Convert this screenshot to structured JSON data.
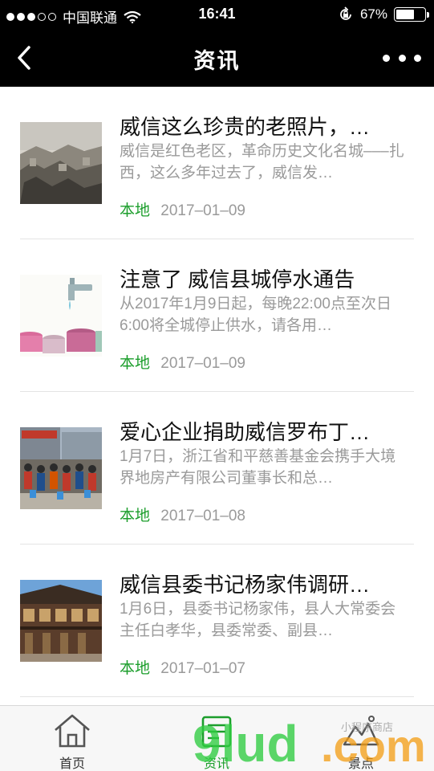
{
  "status_bar": {
    "carrier": "中国联通",
    "time": "16:41",
    "battery": "67%",
    "battery_level": 0.67
  },
  "nav": {
    "title": "资讯"
  },
  "articles": [
    {
      "title": "威信这么珍贵的老照片，…",
      "desc": "威信是红色老区，革命历史文化名城–––扎西，这么多年过去了，威信发…",
      "tag": "本地",
      "date": "2017–01–09",
      "thumb_icon": "old-photo-thumbnail"
    },
    {
      "title": "注意了 威信县城停水通告",
      "desc": "从2017年1月9日起，每晚22:00点至次日6:00将全城停止供水，请各用…",
      "tag": "本地",
      "date": "2017–01–09",
      "thumb_icon": "water-tap-thumbnail"
    },
    {
      "title": "爱心企业捐助威信罗布丁…",
      "desc": "1月7日，浙江省和平慈善基金会携手大境界地房产有限公司董事长和总…",
      "tag": "本地",
      "date": "2017–01–08",
      "thumb_icon": "donation-event-thumbnail"
    },
    {
      "title": "威信县委书记杨家伟调研…",
      "desc": "1月6日，县委书记杨家伟，县人大常委会主任白孝华，县委常委、副县…",
      "tag": "本地",
      "date": "2017–01–07",
      "thumb_icon": "old-street-thumbnail"
    }
  ],
  "tab_bar": {
    "tabs": [
      {
        "label": "首页",
        "icon": "home-icon"
      },
      {
        "label": "资讯",
        "icon": "news-icon"
      },
      {
        "label": "景点",
        "icon": "mountain-icon"
      }
    ],
    "active_index": 1
  },
  "watermark": {
    "text": "9lud.com",
    "sub": "小程序商店"
  },
  "colors": {
    "accent_green": "#1c9e2c",
    "bar_black": "#000000",
    "gray_text": "#9a9a9a"
  }
}
